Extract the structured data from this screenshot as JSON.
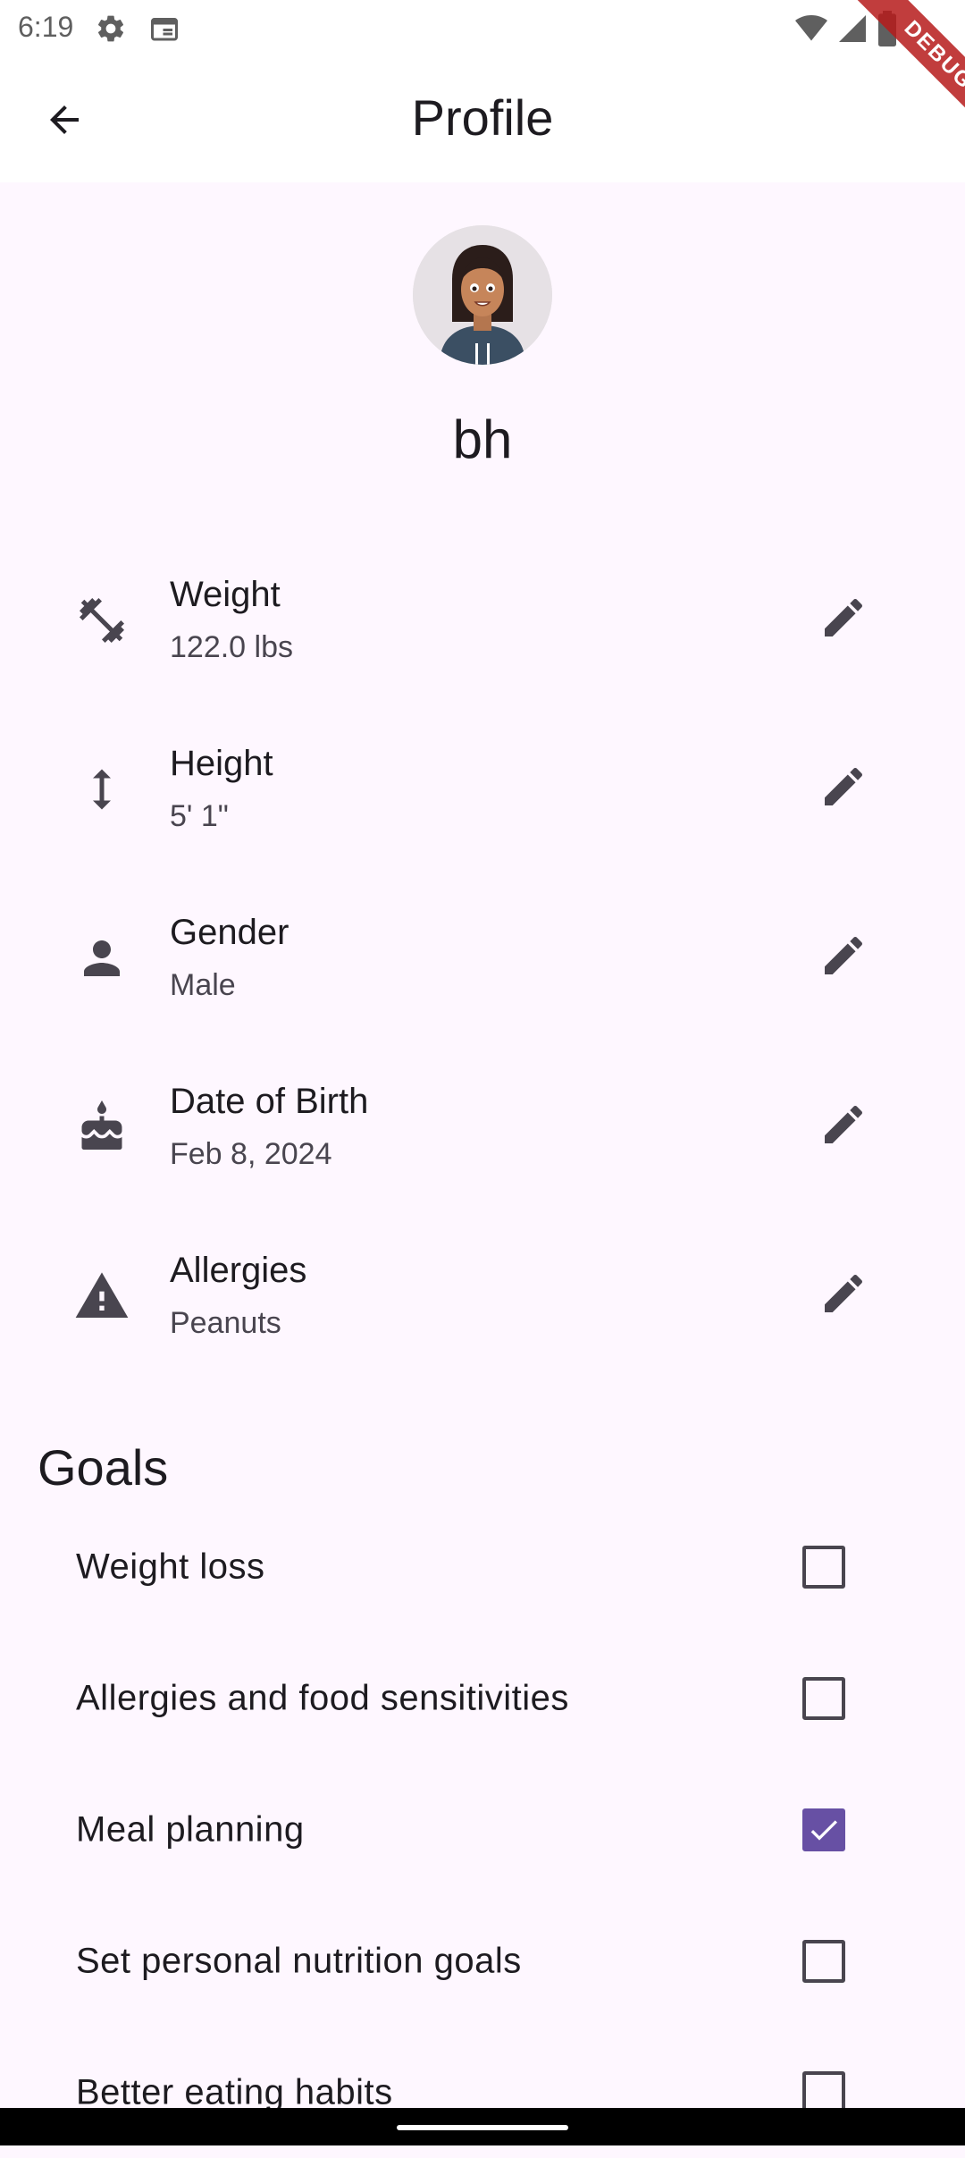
{
  "status": {
    "time": "6:19"
  },
  "app_bar": {
    "title": "Profile"
  },
  "debug_label": "DEBUG",
  "user": {
    "name": "bh"
  },
  "profile_fields": [
    {
      "label": "Weight",
      "value": "122.0 lbs",
      "icon": "fitness-icon"
    },
    {
      "label": "Height",
      "value": "5' 1\"",
      "icon": "height-icon"
    },
    {
      "label": "Gender",
      "value": "Male",
      "icon": "person-icon"
    },
    {
      "label": "Date of Birth",
      "value": "Feb 8, 2024",
      "icon": "cake-icon"
    },
    {
      "label": "Allergies",
      "value": "Peanuts",
      "icon": "warning-icon"
    }
  ],
  "goals": {
    "title": "Goals",
    "items": [
      {
        "label": "Weight loss",
        "checked": false
      },
      {
        "label": "Allergies and food sensitivities",
        "checked": false
      },
      {
        "label": "Meal planning",
        "checked": true
      },
      {
        "label": "Set personal nutrition goals",
        "checked": false
      },
      {
        "label": "Better eating habits",
        "checked": false
      }
    ]
  },
  "colors": {
    "accent": "#6750a4",
    "background": "#fef7ff",
    "icon": "#49454f"
  }
}
